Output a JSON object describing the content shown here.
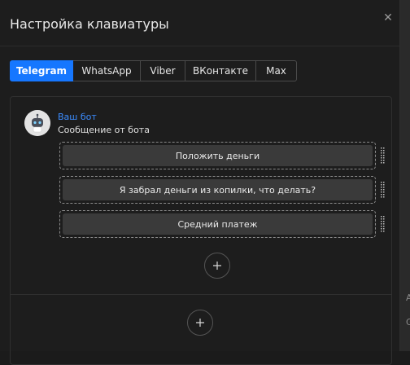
{
  "modal": {
    "title": "Настройка клавиатуры",
    "close_icon": "close-icon"
  },
  "tabs": [
    {
      "label": "Telegram",
      "active": true
    },
    {
      "label": "WhatsApp",
      "active": false
    },
    {
      "label": "Viber",
      "active": false
    },
    {
      "label": "ВКонтакте",
      "active": false
    },
    {
      "label": "Max",
      "active": false
    }
  ],
  "bot": {
    "name": "Ваш бот",
    "subtitle": "Сообщение от бота",
    "avatar_icon": "robot-icon"
  },
  "keyboard_buttons": [
    {
      "label": "Положить деньги"
    },
    {
      "label": "Я забрал деньги из копилки, что делать?"
    },
    {
      "label": "Средний платеж"
    }
  ],
  "add_button_icon": "plus-icon",
  "add_row_icon": "plus-icon",
  "colors": {
    "accent": "#1677ff",
    "bot_name": "#3b8cff",
    "background": "#1d1d1d"
  }
}
